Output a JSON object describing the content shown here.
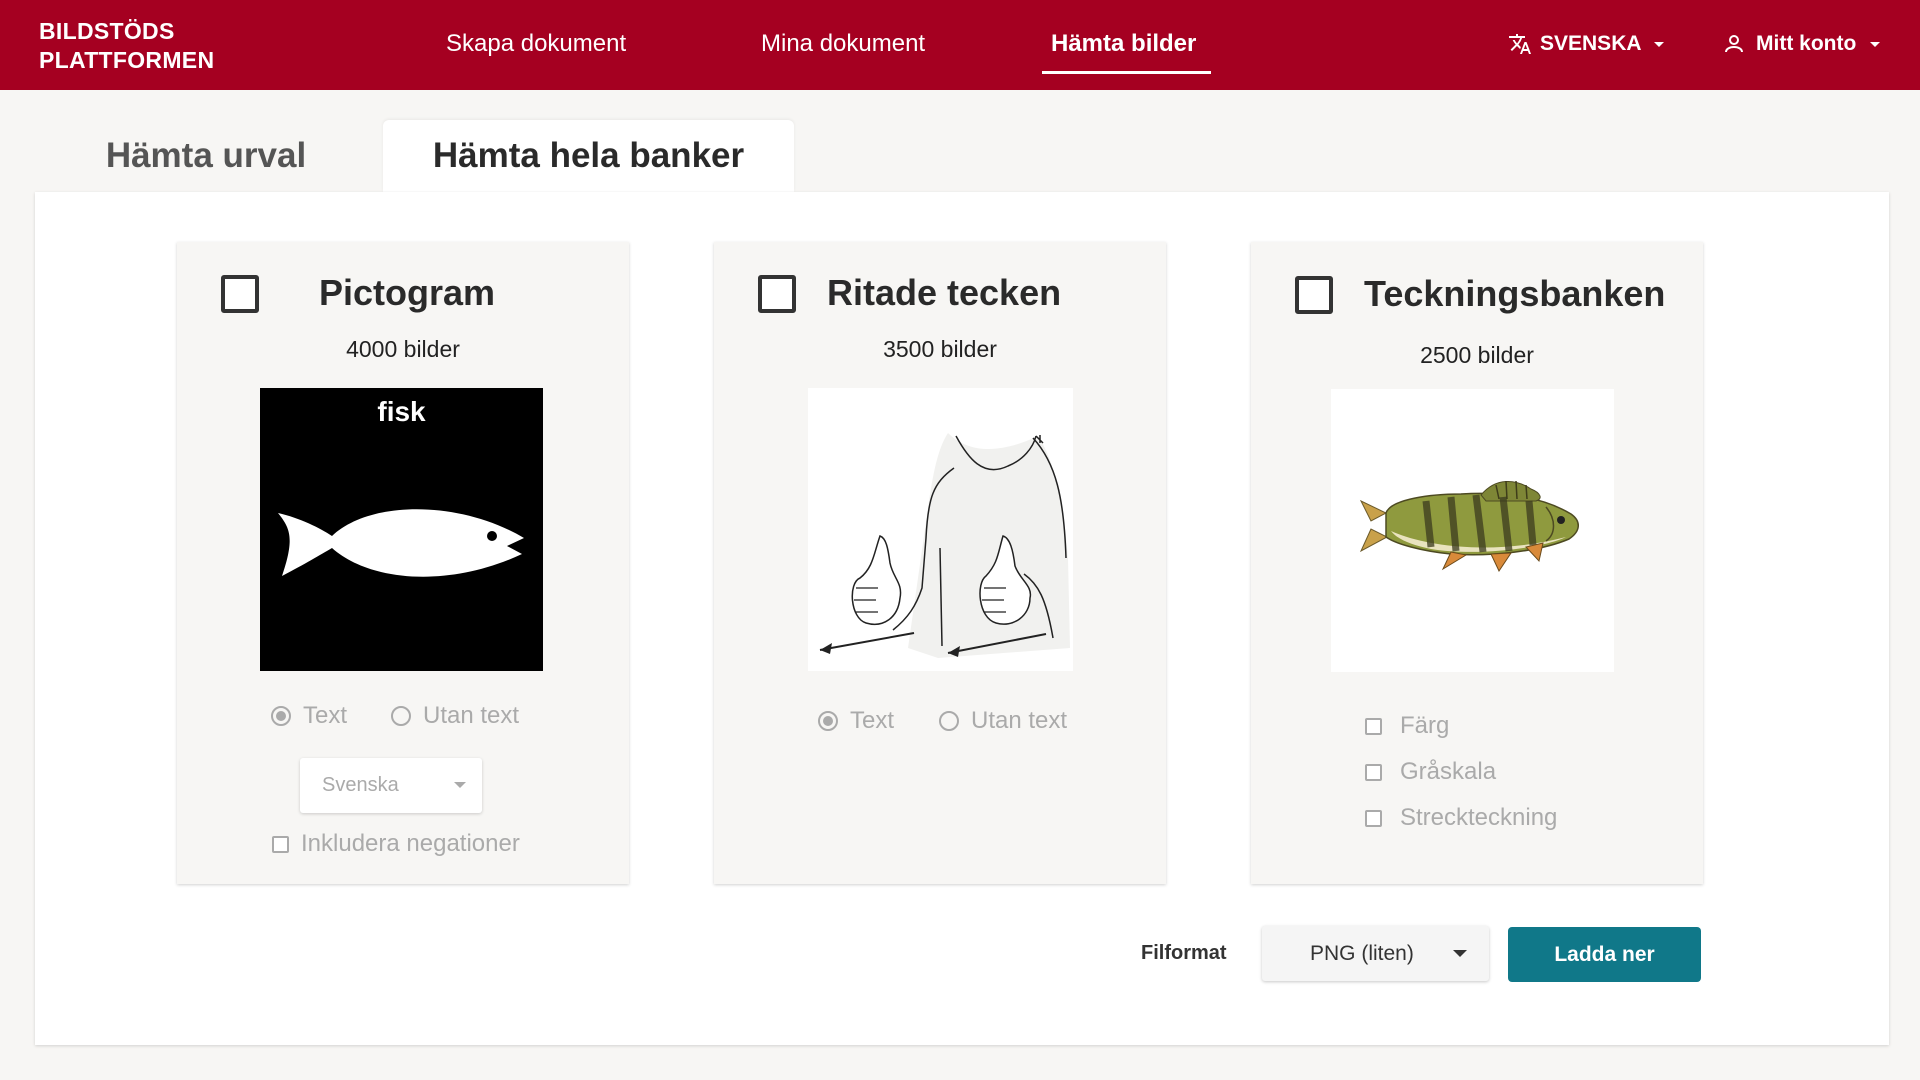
{
  "header": {
    "logo_line1": "BILDSTÖDS",
    "logo_line2": "PLATTFORMEN",
    "nav": [
      {
        "label": "Skapa dokument"
      },
      {
        "label": "Mina dokument"
      },
      {
        "label": "Hämta bilder",
        "active": true
      }
    ],
    "language": "SVENSKA",
    "account": "Mitt konto",
    "icons": {
      "language": "translate-icon",
      "account": "user-icon"
    }
  },
  "tabs": [
    {
      "label": "Hämta urval",
      "active": false
    },
    {
      "label": "Hämta hela banker",
      "active": true
    }
  ],
  "cards": [
    {
      "title": "Pictogram",
      "count": "4000 bilder",
      "image_caption": "fisk",
      "radio_text": "Text",
      "radio_no_text": "Utan text",
      "language_select": "Svenska",
      "include_negations": "Inkludera negationer"
    },
    {
      "title": "Ritade tecken",
      "count": "3500 bilder",
      "radio_text": "Text",
      "radio_no_text": "Utan text"
    },
    {
      "title": "Teckningsbanken",
      "count": "2500 bilder",
      "options": [
        "Färg",
        "Gråskala",
        "Streckteckning"
      ]
    }
  ],
  "footer": {
    "format_label": "Filformat",
    "format_value": "PNG (liten)",
    "download_label": "Ladda ner"
  },
  "colors": {
    "brand": "#a50021",
    "button": "#107889"
  }
}
